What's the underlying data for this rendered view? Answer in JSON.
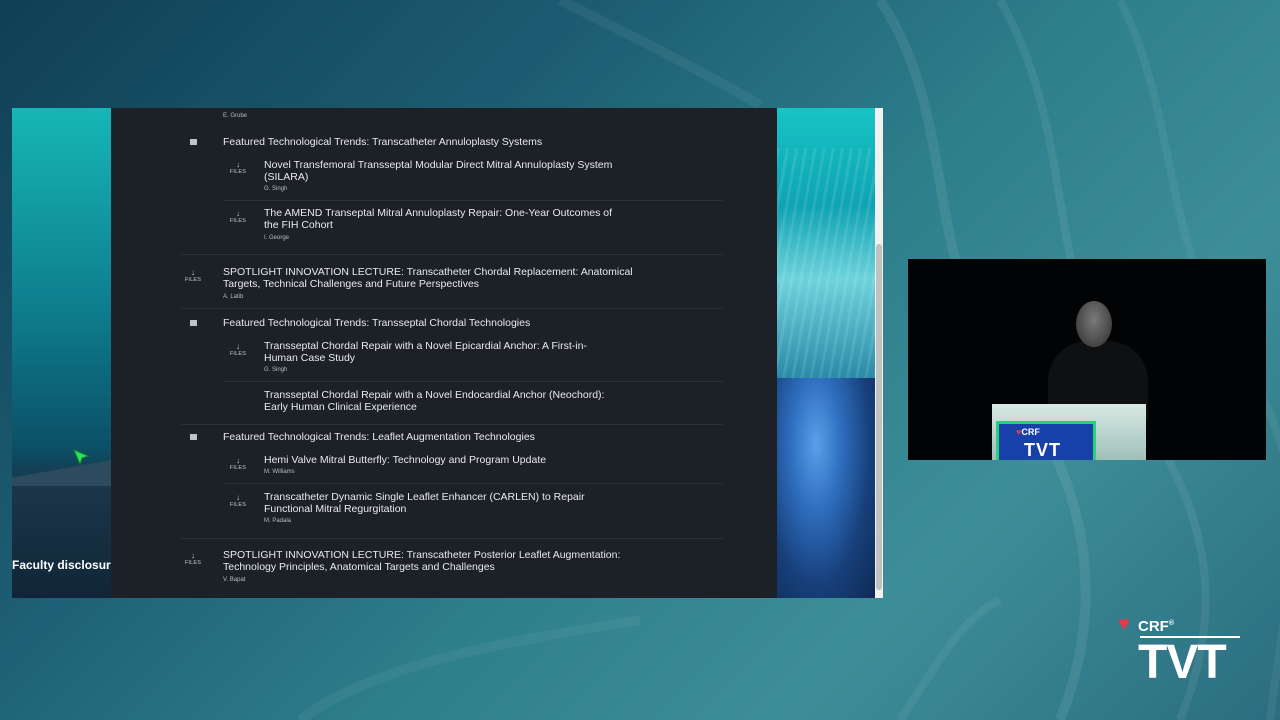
{
  "left_slide": {
    "faculty_text": "Faculty disclosur"
  },
  "agenda": {
    "top_speaker": "E. Grube",
    "files_label": "FILES",
    "files_arrow": "↓",
    "sections": [
      {
        "title": "Featured Technological Trends: Transcatheter Annuloplasty Systems",
        "talks": [
          {
            "title_lines": [
              "Novel Transfemoral Transseptal Modular Direct Mitral Annuloplasty System",
              "(SILARA)"
            ],
            "speaker": "G. Singh"
          },
          {
            "title_lines": [
              "The AMEND Transeptal Mitral Annuloplasty Repair: One-Year Outcomes of",
              "the FIH Cohort"
            ],
            "speaker": "I. George"
          }
        ]
      },
      {
        "title_lines": [
          "SPOTLIGHT INNOVATION LECTURE: Transcatheter Chordal Replacement: Anatomical",
          "Targets, Technical Challenges and Future Perspectives"
        ],
        "speaker": "A. Latib"
      },
      {
        "title": "Featured Technological Trends: Transseptal Chordal Technologies",
        "talks": [
          {
            "title_lines": [
              "Transseptal Chordal Repair with a Novel Epicardial Anchor: A First-in-",
              "Human Case Study"
            ],
            "speaker": "G. Singh"
          },
          {
            "title_lines": [
              "Transseptal Chordal Repair with a Novel Endocardial Anchor (Neochord):",
              "Early Human Clinical Experience"
            ]
          }
        ]
      },
      {
        "title": "Featured Technological Trends: Leaflet Augmentation Technologies",
        "talks": [
          {
            "title_lines": [
              "Hemi Valve Mitral Butterfly: Technology and Program Update"
            ],
            "speaker": "M. Williams"
          },
          {
            "title_lines": [
              "Transcatheter Dynamic Single Leaflet Enhancer (CARLEN) to Repair",
              "Functional Mitral Regurgitation"
            ],
            "speaker": "M. Padala"
          }
        ]
      },
      {
        "title_lines": [
          "SPOTLIGHT INNOVATION LECTURE: Transcatheter Posterior Leaflet Augmentation:",
          "Technology Principles, Anatomical Targets and Challenges"
        ],
        "speaker": "V. Bapat"
      }
    ]
  },
  "podium": {
    "crf": "CRF",
    "tvt": "TVT",
    "heart": "♥"
  },
  "logo": {
    "crf": "CRF",
    "trademark": "®",
    "tvt": "TVT",
    "heart": "♥"
  },
  "colors": {
    "accent_red": "#e6384a",
    "panel_bg": "#1c2127",
    "podium_green": "#2bd07a"
  }
}
